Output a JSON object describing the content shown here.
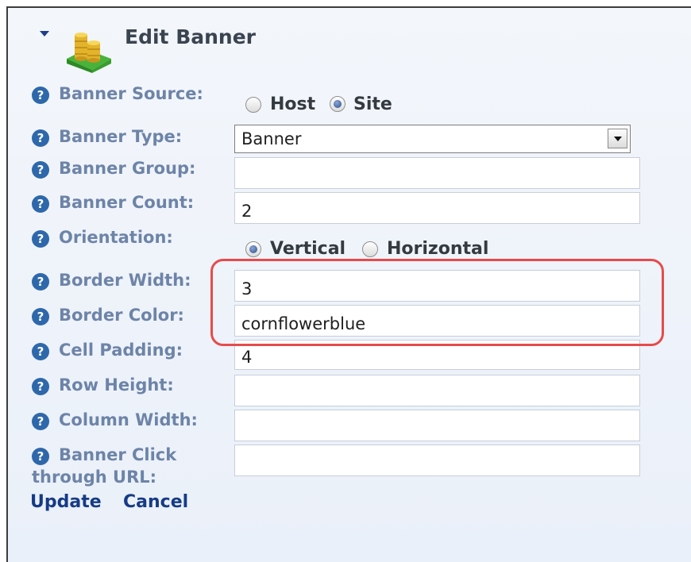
{
  "header": {
    "title": "Edit Banner"
  },
  "fields": {
    "banner_source": {
      "label": "Banner Source:",
      "options": [
        "Host",
        "Site"
      ],
      "selected": "Site"
    },
    "banner_type": {
      "label": "Banner Type:",
      "value": "Banner"
    },
    "banner_group": {
      "label": "Banner Group:",
      "value": ""
    },
    "banner_count": {
      "label": "Banner Count:",
      "value": "2"
    },
    "orientation": {
      "label": "Orientation:",
      "options": [
        "Vertical",
        "Horizontal"
      ],
      "selected": "Vertical"
    },
    "border_width": {
      "label": "Border Width:",
      "value": "3"
    },
    "border_color": {
      "label": "Border Color:",
      "value": "cornflowerblue"
    },
    "cell_padding": {
      "label": "Cell Padding:",
      "value": "4"
    },
    "row_height": {
      "label": "Row Height:",
      "value": ""
    },
    "column_width": {
      "label": "Column Width:",
      "value": ""
    },
    "click_url": {
      "label_line1": "Banner Click",
      "label_line2": "through URL:",
      "value": ""
    }
  },
  "help_glyph": "?",
  "actions": {
    "update": "Update",
    "cancel": "Cancel"
  },
  "colors": {
    "label": "#6d84a8",
    "link": "#163b86",
    "highlight": "#e64b4b",
    "help_icon": "#2e68ab"
  }
}
